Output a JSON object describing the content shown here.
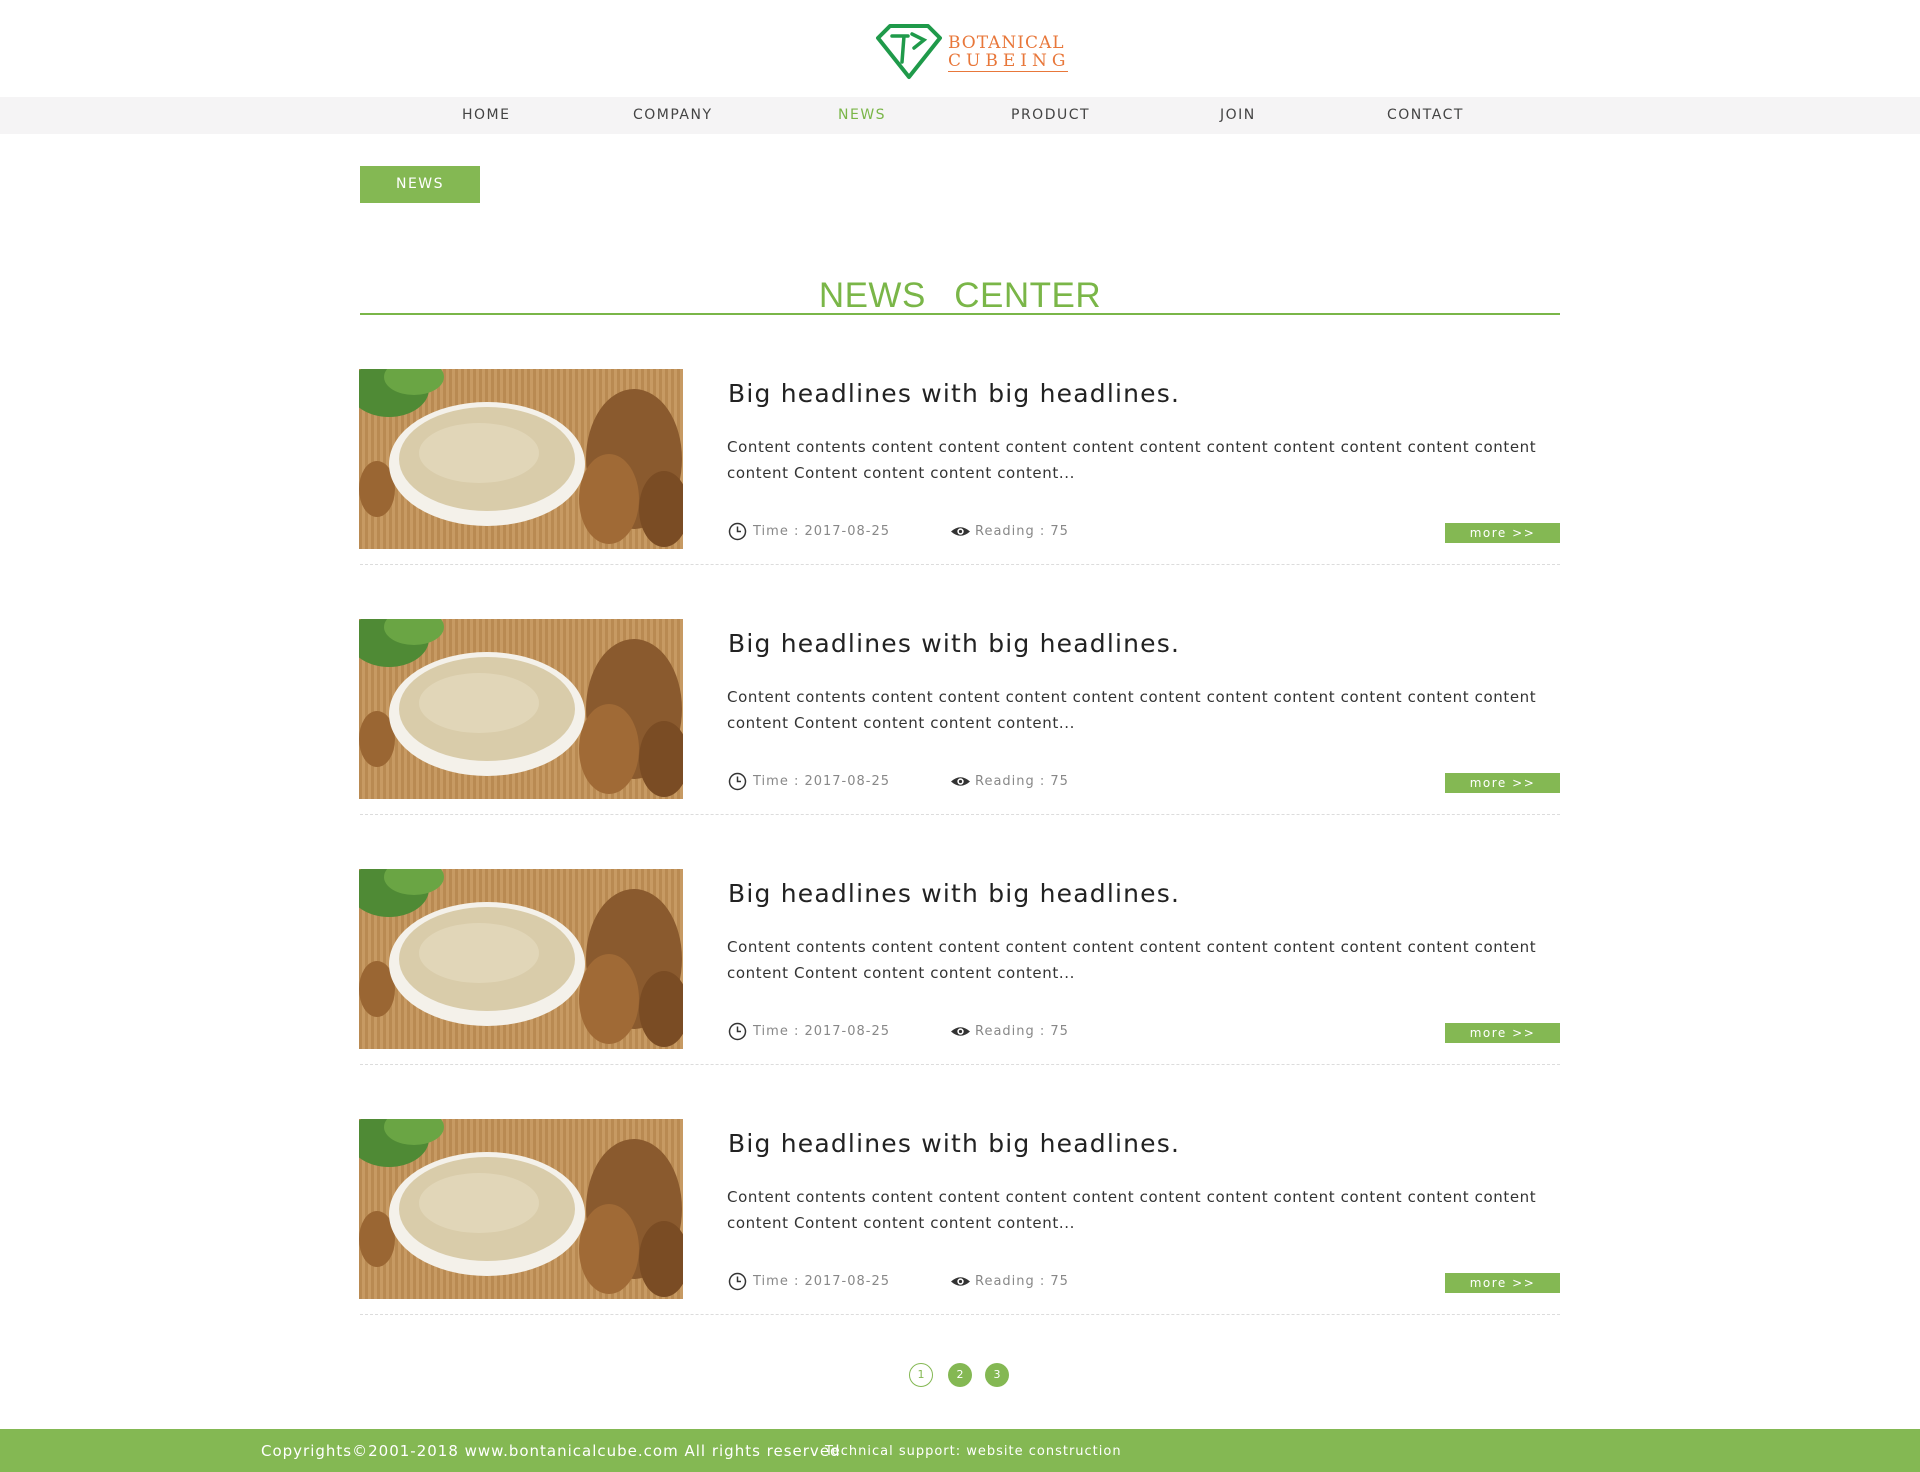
{
  "brand": {
    "line1": "BOTANICAL",
    "line2": "CUBEING",
    "color": "#e8773a",
    "mark_color": "#1f9a4a"
  },
  "nav": {
    "items": [
      {
        "label": "HOME",
        "active": false
      },
      {
        "label": "COMPANY",
        "active": false
      },
      {
        "label": "NEWS",
        "active": true
      },
      {
        "label": "PRODUCT",
        "active": false
      },
      {
        "label": "JOIN",
        "active": false
      },
      {
        "label": "CONTACT",
        "active": false
      }
    ]
  },
  "breadcrumb": {
    "label": "NEWS"
  },
  "section": {
    "title": "NEWS  CENTER"
  },
  "news": [
    {
      "title": "Big headlines with big headlines.",
      "summary": "Content contents content content content  content content content content content content content  content Content content content content...",
      "time": "Time : 2017-08-25",
      "reading": "Reading : 75",
      "more": "more >>"
    },
    {
      "title": "Big headlines with big headlines.",
      "summary": "Content contents content content content  content content content content content content content  content Content content content content...",
      "time": "Time : 2017-08-25",
      "reading": "Reading : 75",
      "more": "more >>"
    },
    {
      "title": "Big headlines with big headlines.",
      "summary": "Content contents content content content  content content content content content content content  content Content content content content...",
      "time": "Time : 2017-08-25",
      "reading": "Reading : 75",
      "more": "more >>"
    },
    {
      "title": "Big headlines with big headlines.",
      "summary": "Content contents content content content  content content content content content content content  content Content content content content...",
      "time": "Time : 2017-08-25",
      "reading": "Reading : 75",
      "more": "more >>"
    }
  ],
  "pagination": {
    "pages": [
      "1",
      "2",
      "3"
    ],
    "current": "1"
  },
  "footer": {
    "copyright": "Copyrights©2001-2018 www.bontanicalcube.com All rights reserved",
    "support": "Technical support: website construction"
  },
  "colors": {
    "accent": "#84b853",
    "title_green": "#7ab648"
  }
}
